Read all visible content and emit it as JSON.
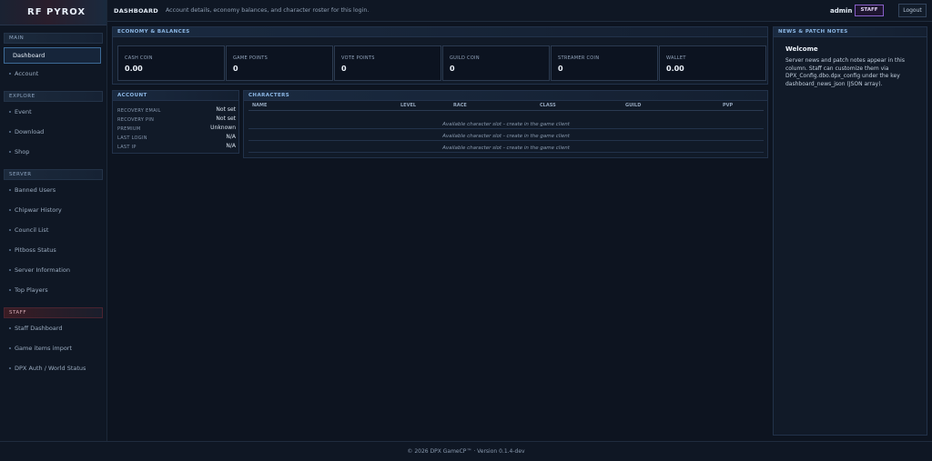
{
  "brand": "RF PYROX",
  "header": {
    "title": "DASHBOARD",
    "subtitle": "Account details, economy balances, and character roster for this login.",
    "user": "admin",
    "role_badge": "STAFF",
    "logout": "Logout"
  },
  "sidebar": {
    "sections": [
      {
        "title": "MAIN",
        "items": [
          "Dashboard",
          "Account"
        ]
      },
      {
        "title": "EXPLORE",
        "items": [
          "Event",
          "Download",
          "Shop"
        ]
      },
      {
        "title": "SERVER",
        "items": [
          "Banned Users",
          "Chipwar History",
          "Council List",
          "Pitboss Status",
          "Server Information",
          "Top Players"
        ]
      },
      {
        "title": "STAFF",
        "items": [
          "Staff Dashboard",
          "Game items import",
          "DPX Auth / World Status"
        ]
      }
    ]
  },
  "economy": {
    "title": "ECONOMY & BALANCES",
    "boxes": [
      {
        "label": "CASH COIN",
        "value": "0.00"
      },
      {
        "label": "GAME POINTS",
        "value": "0"
      },
      {
        "label": "VOTE POINTS",
        "value": "0"
      },
      {
        "label": "GUILD COIN",
        "value": "0"
      },
      {
        "label": "STREAMER COIN",
        "value": "0"
      },
      {
        "label": "WALLET",
        "value": "0.00"
      }
    ]
  },
  "account": {
    "title": "ACCOUNT",
    "rows": [
      {
        "key": "RECOVERY EMAIL",
        "value": "Not set"
      },
      {
        "key": "RECOVERY PIN",
        "value": "Not set"
      },
      {
        "key": "PREMIUM",
        "value": "Unknown"
      },
      {
        "key": "LAST LOGIN",
        "value": "N/A"
      },
      {
        "key": "LAST IP",
        "value": "N/A"
      }
    ]
  },
  "characters": {
    "title": "CHARACTERS",
    "columns": [
      "NAME",
      "LEVEL",
      "RACE",
      "CLASS",
      "GUILD",
      "PVP"
    ],
    "slots": [
      "Available character slot - create in the game client",
      "Available character slot - create in the game client",
      "Available character slot - create in the game client"
    ]
  },
  "news": {
    "title": "NEWS & PATCH NOTES",
    "heading": "Welcome",
    "body": "Server news and patch notes appear in this column. Staff can customize them via DPX_Config.dbo.dpx_config under the key dashboard_news_json (JSON array)."
  },
  "footer": "© 2026 DPX GameCP™ · Version 0.1.4-dev",
  "colors": {
    "accent": "#3d6a96",
    "staff_badge": "#8860c8",
    "panel_bg": "#111a28"
  }
}
